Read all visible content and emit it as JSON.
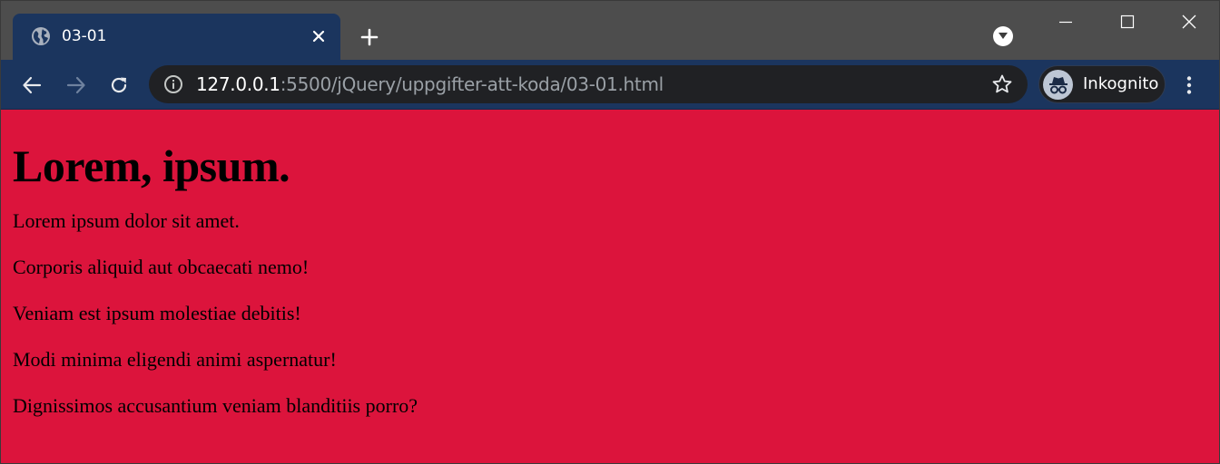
{
  "browser": {
    "tab": {
      "title": "03-01",
      "favicon": "globe-icon"
    },
    "url": {
      "host": "127.0.0.1",
      "rest": ":5500/jQuery/uppgifter-att-koda/03-01.html"
    },
    "profile_label": "Inkognito",
    "colors": {
      "frame": "#4d4d4d",
      "toolbar": "#1b355e",
      "omnibox": "#202124"
    }
  },
  "page": {
    "background": "#dc143c",
    "heading": "Lorem, ipsum.",
    "paragraphs": [
      "Lorem ipsum dolor sit amet.",
      "Corporis aliquid aut obcaecati nemo!",
      "Veniam est ipsum molestiae debitis!",
      "Modi minima eligendi animi aspernatur!",
      "Dignissimos accusantium veniam blanditiis porro?"
    ]
  }
}
